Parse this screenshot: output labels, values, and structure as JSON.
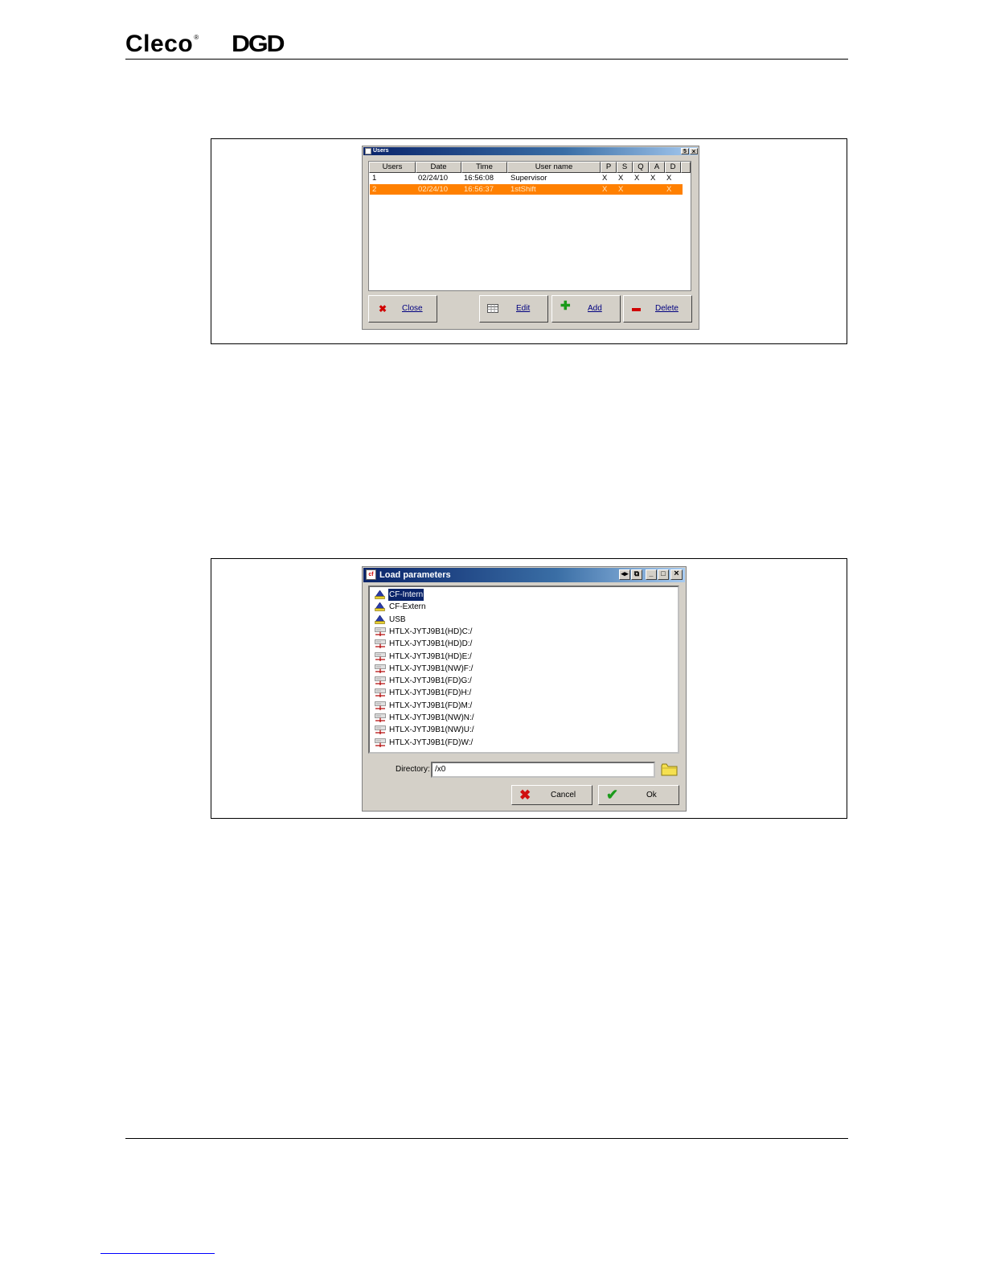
{
  "header": {
    "brand_cleco": "Cleco",
    "brand_reg": "®",
    "brand_dgd": "DGD"
  },
  "users_dialog": {
    "title": "Users",
    "title_buttons": [
      "5",
      "×"
    ],
    "columns": [
      "Users",
      "Date",
      "Time",
      "User name",
      "P",
      "S",
      "Q",
      "A",
      "D"
    ],
    "rows": [
      {
        "id": "1",
        "date": "02/24/10",
        "time": "16:56:08",
        "name": "Supervisor",
        "p": "X",
        "s": "X",
        "q": "X",
        "a": "X",
        "d": "X",
        "selected": false
      },
      {
        "id": "2",
        "date": "02/24/10",
        "time": "16:56:37",
        "name": "1stShift",
        "p": "X",
        "s": "X",
        "q": "",
        "a": "",
        "d": "X",
        "selected": true
      }
    ],
    "buttons": {
      "close": "Close",
      "edit": "Edit",
      "add": "Add",
      "delete": "Delete"
    },
    "selection_color": "#ff8000"
  },
  "load_dialog": {
    "title": "Load parameters",
    "title_buttons": [
      "◂▸",
      "⧉",
      "_",
      "□",
      "×"
    ],
    "tree_items": [
      {
        "label": "CF-Intern",
        "type": "drive",
        "selected": true
      },
      {
        "label": "CF-Extern",
        "type": "drive",
        "selected": false
      },
      {
        "label": "USB",
        "type": "drive",
        "selected": false
      },
      {
        "label": "HTLX-JYTJ9B1(HD)C:/",
        "type": "network",
        "selected": false
      },
      {
        "label": "HTLX-JYTJ9B1(HD)D:/",
        "type": "network",
        "selected": false
      },
      {
        "label": "HTLX-JYTJ9B1(HD)E:/",
        "type": "network",
        "selected": false
      },
      {
        "label": "HTLX-JYTJ9B1(NW)F:/",
        "type": "network",
        "selected": false
      },
      {
        "label": "HTLX-JYTJ9B1(FD)G:/",
        "type": "network",
        "selected": false
      },
      {
        "label": "HTLX-JYTJ9B1(FD)H:/",
        "type": "network",
        "selected": false
      },
      {
        "label": "HTLX-JYTJ9B1(FD)M:/",
        "type": "network",
        "selected": false
      },
      {
        "label": "HTLX-JYTJ9B1(NW)N:/",
        "type": "network",
        "selected": false
      },
      {
        "label": "HTLX-JYTJ9B1(NW)U:/",
        "type": "network",
        "selected": false
      },
      {
        "label": "HTLX-JYTJ9B1(FD)W:/",
        "type": "network",
        "selected": false
      }
    ],
    "directory_label": "Directory:",
    "directory_value": "/x0",
    "buttons": {
      "cancel": "Cancel",
      "ok": "Ok"
    }
  }
}
